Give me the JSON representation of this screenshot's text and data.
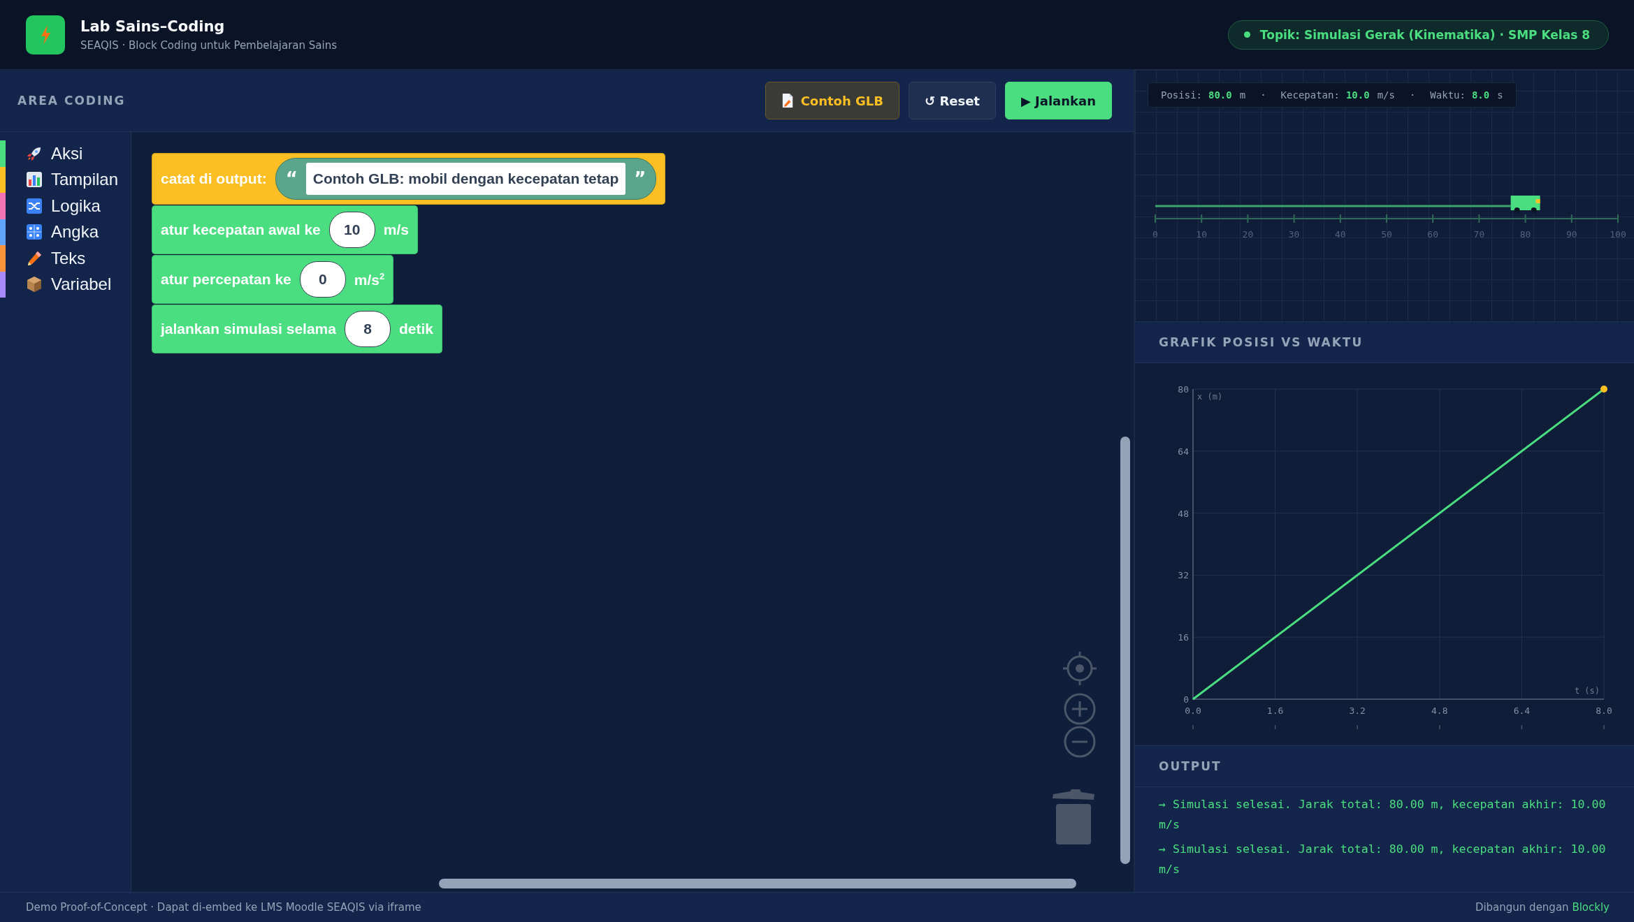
{
  "header": {
    "title": "Lab Sains–Coding",
    "subtitle": "SEAQIS · Block Coding untuk Pembelajaran Sains",
    "topic": "Topik: Simulasi Gerak (Kinematika) · SMP Kelas 8"
  },
  "coding": {
    "title": "AREA CODING",
    "buttons": [
      {
        "kind": "example",
        "label": "Contoh GLB"
      },
      {
        "kind": "secondary",
        "label": "↺ Reset"
      },
      {
        "kind": "primary",
        "label": "▶ Jalankan"
      }
    ]
  },
  "toolbox": [
    {
      "label": "Aksi",
      "color": "#4ade80"
    },
    {
      "label": "Tampilan",
      "color": "#fbbf24"
    },
    {
      "label": "Logika",
      "color": "#f472b6"
    },
    {
      "label": "Angka",
      "color": "#60a5fa"
    },
    {
      "label": "Teks",
      "color": "#fb923c"
    },
    {
      "label": "Variabel",
      "color": "#a78bfa"
    }
  ],
  "blocks": [
    {
      "color": "#fbbf24",
      "parts": [
        {
          "kind": "label",
          "text": "catat di output:"
        },
        {
          "kind": "string",
          "open": "“",
          "text": "Contoh GLB: mobil dengan kecepatan tetap",
          "close": "”"
        }
      ]
    },
    {
      "color": "#4ade80",
      "parts": [
        {
          "kind": "label",
          "text": "atur kecepatan awal ke"
        },
        {
          "kind": "number",
          "text": "10"
        },
        {
          "kind": "label",
          "text": "m/s"
        }
      ]
    },
    {
      "color": "#4ade80",
      "parts": [
        {
          "kind": "label",
          "text": "atur percepatan ke"
        },
        {
          "kind": "number",
          "text": "0"
        },
        {
          "kind": "label",
          "text": "m/s$^{2}$"
        }
      ]
    },
    {
      "color": "#4ade80",
      "parts": [
        {
          "kind": "label",
          "text": "jalankan simulasi selama"
        },
        {
          "kind": "number",
          "text": "8"
        },
        {
          "kind": "label",
          "text": "detik"
        }
      ]
    }
  ],
  "simulation": {
    "stats": [
      {
        "kind": "stat",
        "label": "Posisi:",
        "value": "80.0",
        "unit": "m"
      },
      {
        "kind": "sep",
        "text": "·"
      },
      {
        "kind": "stat",
        "label": "Kecepatan:",
        "value": "10.0",
        "unit": "m/s"
      },
      {
        "kind": "sep",
        "text": "·"
      },
      {
        "kind": "stat",
        "label": "Waktu:",
        "value": "8.0",
        "unit": "s"
      }
    ],
    "track": {
      "level": 0.8,
      "labels": [
        "0",
        "10",
        "20",
        "30",
        "40",
        "50",
        "60",
        "70",
        "80",
        "90",
        "100"
      ]
    }
  },
  "chart": {
    "title": "GRAFIK POSISI VS WAKTU",
    "chart_data": {
      "type": "line",
      "xlabel": "t (s)",
      "ylabel": "x (m)",
      "x": [
        0,
        8
      ],
      "series": [
        {
          "color": "#4ade80",
          "values": [
            0,
            80
          ]
        }
      ],
      "grid": true,
      "xlim": [
        0,
        8
      ],
      "ylim": [
        0,
        80
      ],
      "xticks": [
        {
          "value": 0,
          "label": "0.0"
        },
        {
          "value": 1.6,
          "label": "1.6"
        },
        {
          "value": 3.2,
          "label": "3.2"
        },
        {
          "value": 4.8,
          "label": "4.8"
        },
        {
          "value": 6.4,
          "label": "6.4"
        },
        {
          "value": 8,
          "label": "8.0"
        }
      ],
      "yticks": [
        0,
        16,
        32,
        48,
        64,
        80
      ]
    }
  },
  "output": {
    "title": "OUTPUT",
    "lines": [
      "→ Simulasi selesai. Jarak total: 80.00 m, kecepatan akhir: 10.00 m/s",
      "→ Simulasi selesai. Jarak total: 80.00 m, kecepatan akhir: 10.00 m/s"
    ]
  },
  "footer": {
    "text": "Demo Proof-of-Concept · Dapat di-embed ke LMS Moodle SEAQIS via iframe",
    "credit": "Dibangun dengan",
    "link": "Blockly"
  }
}
